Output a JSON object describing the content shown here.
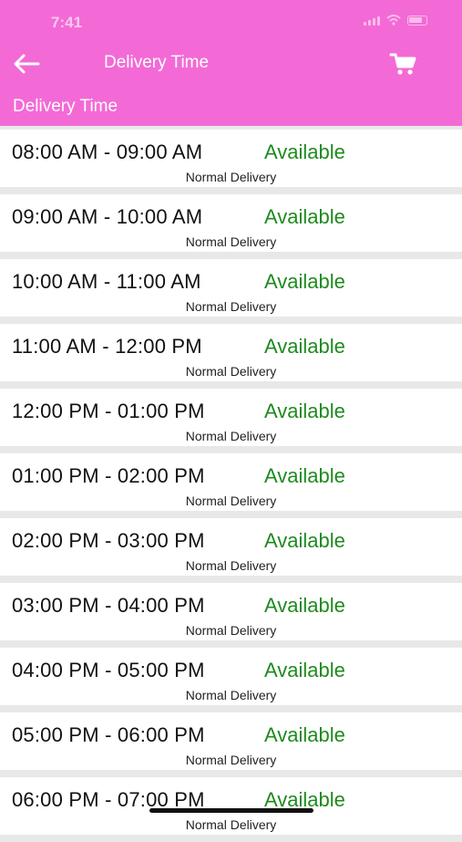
{
  "status_bar": {
    "time": "7:41"
  },
  "app_bar": {
    "back_icon": "arrow-left-icon",
    "title": "Delivery Time",
    "cart_icon": "cart-icon"
  },
  "sub_header": {
    "title": "Delivery Time"
  },
  "slots": [
    {
      "time": "08:00 AM - 09:00 AM",
      "status": "Available",
      "type": "Normal Delivery"
    },
    {
      "time": "09:00 AM - 10:00 AM",
      "status": "Available",
      "type": "Normal Delivery"
    },
    {
      "time": "10:00 AM - 11:00 AM",
      "status": "Available",
      "type": "Normal Delivery"
    },
    {
      "time": "11:00 AM - 12:00 PM",
      "status": "Available",
      "type": "Normal Delivery"
    },
    {
      "time": "12:00 PM - 01:00 PM",
      "status": "Available",
      "type": "Normal Delivery"
    },
    {
      "time": "01:00 PM - 02:00 PM",
      "status": "Available",
      "type": "Normal Delivery"
    },
    {
      "time": "02:00 PM - 03:00 PM",
      "status": "Available",
      "type": "Normal Delivery"
    },
    {
      "time": "03:00 PM - 04:00 PM",
      "status": "Available",
      "type": "Normal Delivery"
    },
    {
      "time": "04:00 PM - 05:00 PM",
      "status": "Available",
      "type": "Normal Delivery"
    },
    {
      "time": "05:00 PM - 06:00 PM",
      "status": "Available",
      "type": "Normal Delivery"
    },
    {
      "time": "06:00 PM - 07:00 PM",
      "status": "Available",
      "type": "Normal Delivery"
    }
  ],
  "colors": {
    "header": "#f36ad6",
    "available": "#1e8a1e",
    "background": "#e8e8e8"
  }
}
